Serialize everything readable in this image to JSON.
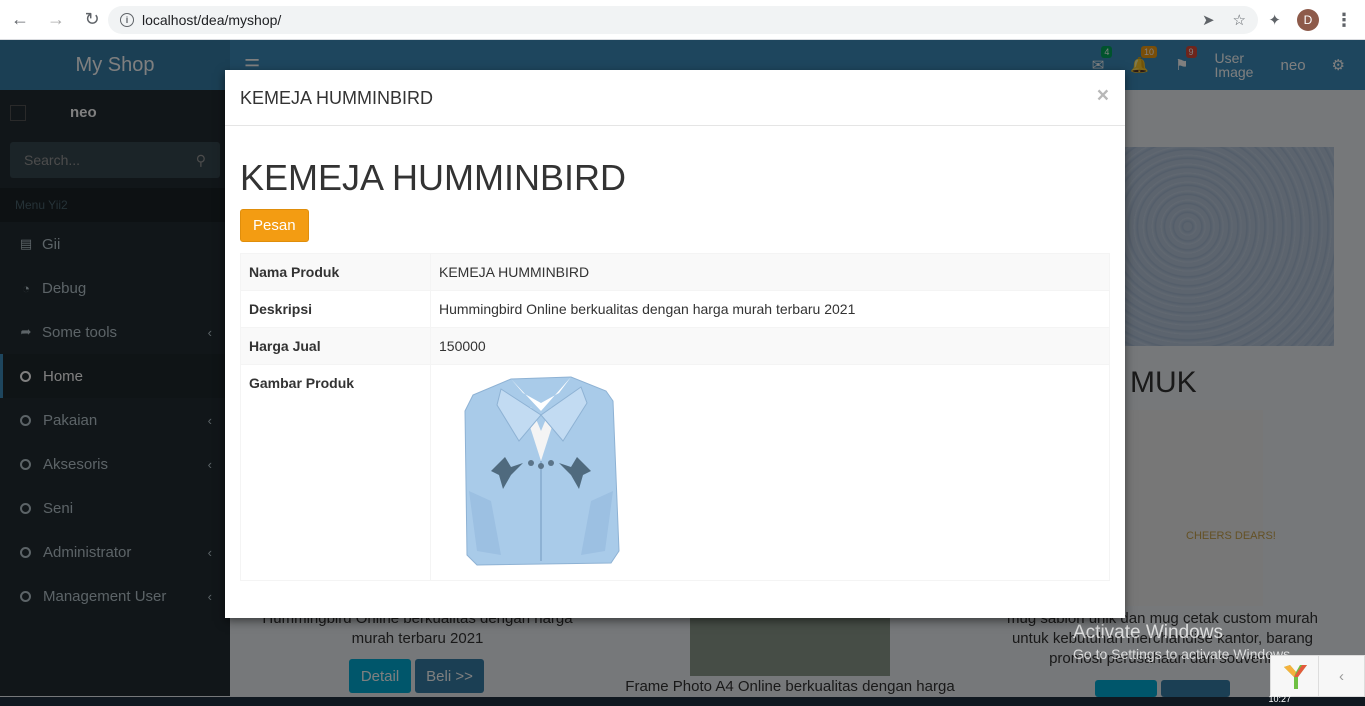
{
  "browser": {
    "url": "localhost/dea/myshop/",
    "profile_initial": "D"
  },
  "app": {
    "logo": "My Shop",
    "user_image_alt": "User Image",
    "user_name": "neo",
    "badges": {
      "messages": "4",
      "notifications": "10",
      "flags": "9"
    }
  },
  "sidebar": {
    "user_name": "neo",
    "search_placeholder": "Search...",
    "menu_header": "Menu Yii2",
    "items": [
      {
        "label": "Gii"
      },
      {
        "label": "Debug"
      },
      {
        "label": "Some tools"
      },
      {
        "label": "Home"
      },
      {
        "label": "Pakaian"
      },
      {
        "label": "Aksesoris"
      },
      {
        "label": "Seni"
      },
      {
        "label": "Administrator"
      },
      {
        "label": "Management User"
      }
    ]
  },
  "background": {
    "right_title": "MUK",
    "cup_text": "CHEERS DEARS!",
    "left_desc": "Hummingbird Online berkualitas dengan harga murah terbaru 2021",
    "mid_desc": "Frame Photo A4 Online berkualitas dengan harga",
    "right_desc": "mug sablon unik dan mug cetak custom murah untuk kebutuhan merchandise kantor, barang promosi perusahaan dan souvenir",
    "detail_label": "Detail",
    "buy_label": "Beli >>"
  },
  "modal": {
    "title": "KEMEJA HUMMINBIRD",
    "close": "×",
    "heading": "KEMEJA HUMMINBIRD",
    "order_button": "Pesan",
    "rows": [
      {
        "label": "Nama Produk",
        "value": "KEMEJA HUMMINBIRD"
      },
      {
        "label": "Deskripsi",
        "value": "Hummingbird Online berkualitas dengan harga murah terbaru 2021"
      },
      {
        "label": "Harga Jual",
        "value": "150000"
      },
      {
        "label": "Gambar Produk"
      }
    ]
  },
  "watermark": {
    "title": "Activate Windows",
    "subtitle": "Go to Settings to activate Windows."
  },
  "taskbar": {
    "clock": "10:27"
  },
  "colors": {
    "primary": "#3c8dbc",
    "sidebar": "#222d32",
    "warning": "#f39c12",
    "shirt": "#a9cbe9"
  }
}
